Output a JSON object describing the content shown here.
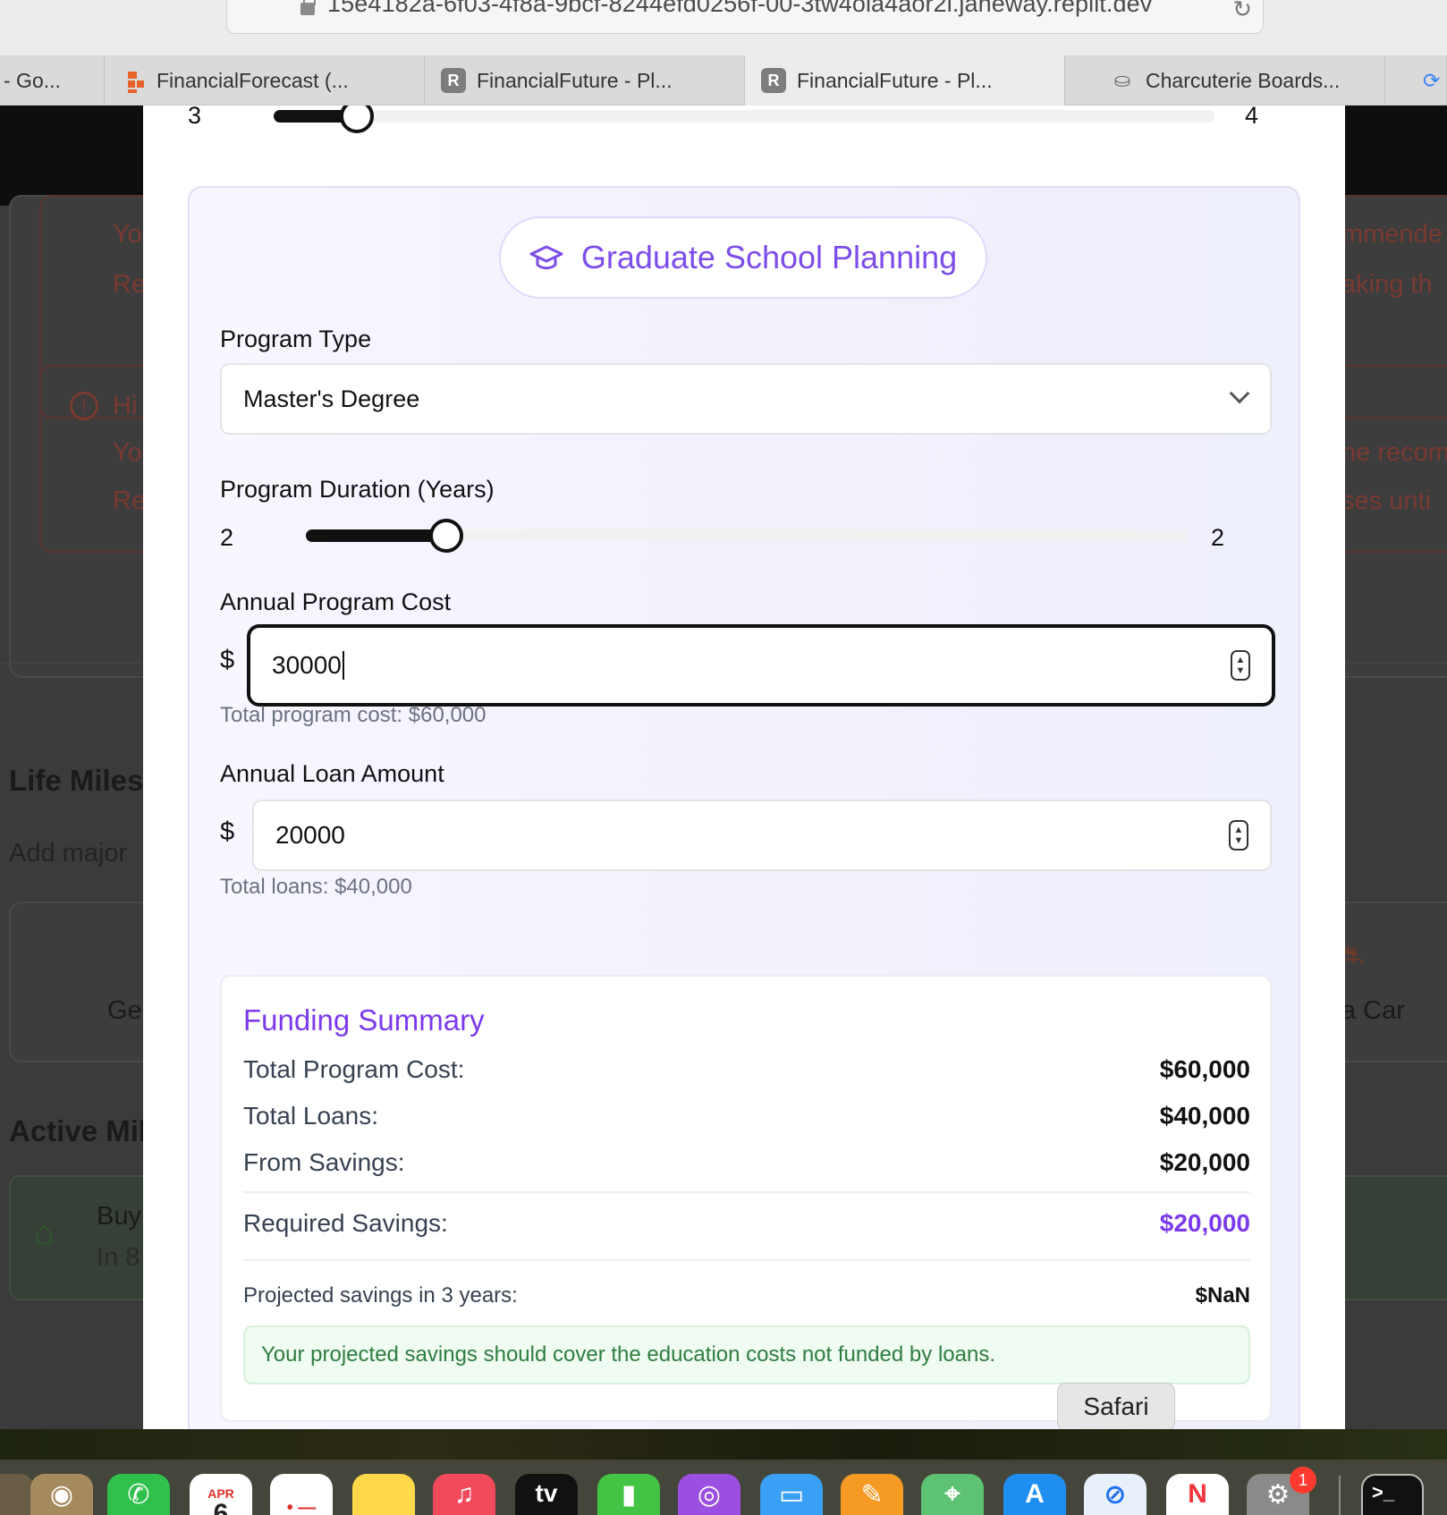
{
  "browser": {
    "url": "15e4182a-6f03-4f8a-9bcf-8244efd0256f-00-3tw4ola4aor2i.janeway.replit.dev",
    "tabs": [
      {
        "label": "- Go...",
        "icon": "none",
        "active": false
      },
      {
        "label": "FinancialForecast (...",
        "icon": "figma-like-icon",
        "active": false
      },
      {
        "label": "FinancialFuture - Pl...",
        "icon": "replit-icon",
        "active": false
      },
      {
        "label": "FinancialFuture - Pl...",
        "icon": "replit-icon",
        "active": true
      },
      {
        "label": "Charcuterie Boards...",
        "icon": "cheese-icon",
        "active": false
      }
    ]
  },
  "background": {
    "fragments": [
      "Yo",
      "Re",
      "Hi",
      "Yo",
      "Re",
      "mmende",
      "aking th",
      "ne recom",
      "ses unti",
      "Life Miles",
      "Add major",
      "Ge",
      "a Car",
      "Active Mile",
      "Buy",
      "In 8"
    ]
  },
  "modal": {
    "top_slider": {
      "min_label": "3",
      "max_label": "4",
      "value_fraction": 0.08
    },
    "header_title": "Graduate School Planning",
    "program_type": {
      "label": "Program Type",
      "value": "Master's Degree"
    },
    "program_duration": {
      "label": "Program Duration (Years)",
      "min_label": "2",
      "max_label": "2",
      "value_fraction": 0.15
    },
    "annual_cost": {
      "label": "Annual Program Cost",
      "currency": "$",
      "value": "30000",
      "hint": "Total program cost: $60,000"
    },
    "annual_loan": {
      "label": "Annual Loan Amount",
      "currency": "$",
      "value": "20000",
      "hint": "Total loans: $40,000"
    },
    "summary": {
      "title": "Funding Summary",
      "rows": [
        {
          "label": "Total Program Cost:",
          "value": "$60,000"
        },
        {
          "label": "Total Loans:",
          "value": "$40,000"
        },
        {
          "label": "From Savings:",
          "value": "$20,000"
        }
      ],
      "required": {
        "label": "Required Savings:",
        "value": "$20,000"
      },
      "projected": {
        "label": "Projected savings in 3 years:",
        "value": "$NaN"
      },
      "message": "Your projected savings should cover the education costs not funded by loans."
    }
  },
  "tooltip": "Safari",
  "dock": {
    "calendar_month": "APR",
    "calendar_day": "6",
    "tv_label": "tv",
    "settings_badge": "1",
    "terminal_prompt": ">_"
  },
  "colors": {
    "accent": "#7c3aed",
    "success": "#2e7d40",
    "border": "#e4e4e7"
  }
}
